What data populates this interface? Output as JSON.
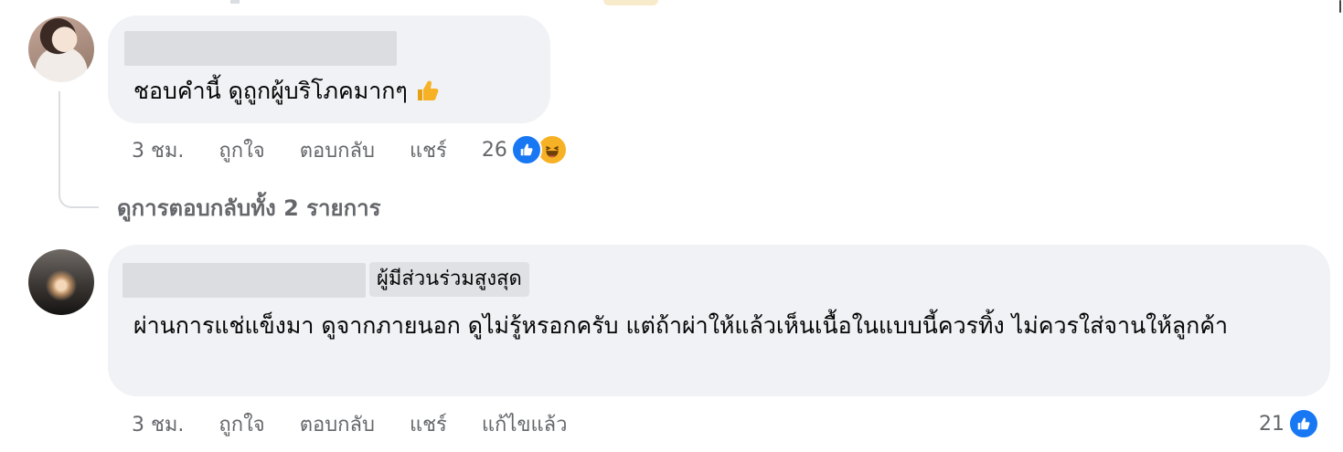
{
  "comments": [
    {
      "text": "ชอบคำนี้ ดูถูกผู้บริโภคมากๆ",
      "text_emoji_icon": "thumbs-up-emoji",
      "actions": {
        "time": "3 ชม.",
        "like": "ถูกใจ",
        "reply": "ตอบกลับ",
        "share": "แชร์"
      },
      "reaction_count": "26",
      "reaction_icons": [
        "like-icon",
        "haha-icon"
      ],
      "view_replies": "ดูการตอบกลับทั้ง 2 รายการ"
    },
    {
      "badge": "ผู้มีส่วนร่วมสูงสุด",
      "text": "ผ่านการแช่แข็งมา ดูจากภายนอก ดูไม่รู้หรอกครับ แต่ถ้าผ่าให้แล้วเห็นเนื้อในแบบนี้ควรทิ้ง ไม่ควรใส่จานให้ลูกค้า",
      "actions": {
        "time": "3 ชม.",
        "like": "ถูกใจ",
        "reply": "ตอบกลับ",
        "share": "แชร์",
        "edited": "แก้ไขแล้ว"
      },
      "reaction_count": "21",
      "reaction_icons": [
        "like-icon"
      ]
    }
  ],
  "colors": {
    "bubble": "#f0f2f5",
    "secondary_text": "#65676b",
    "like_blue": "#1877f2",
    "haha_yellow": "#f7b125"
  }
}
